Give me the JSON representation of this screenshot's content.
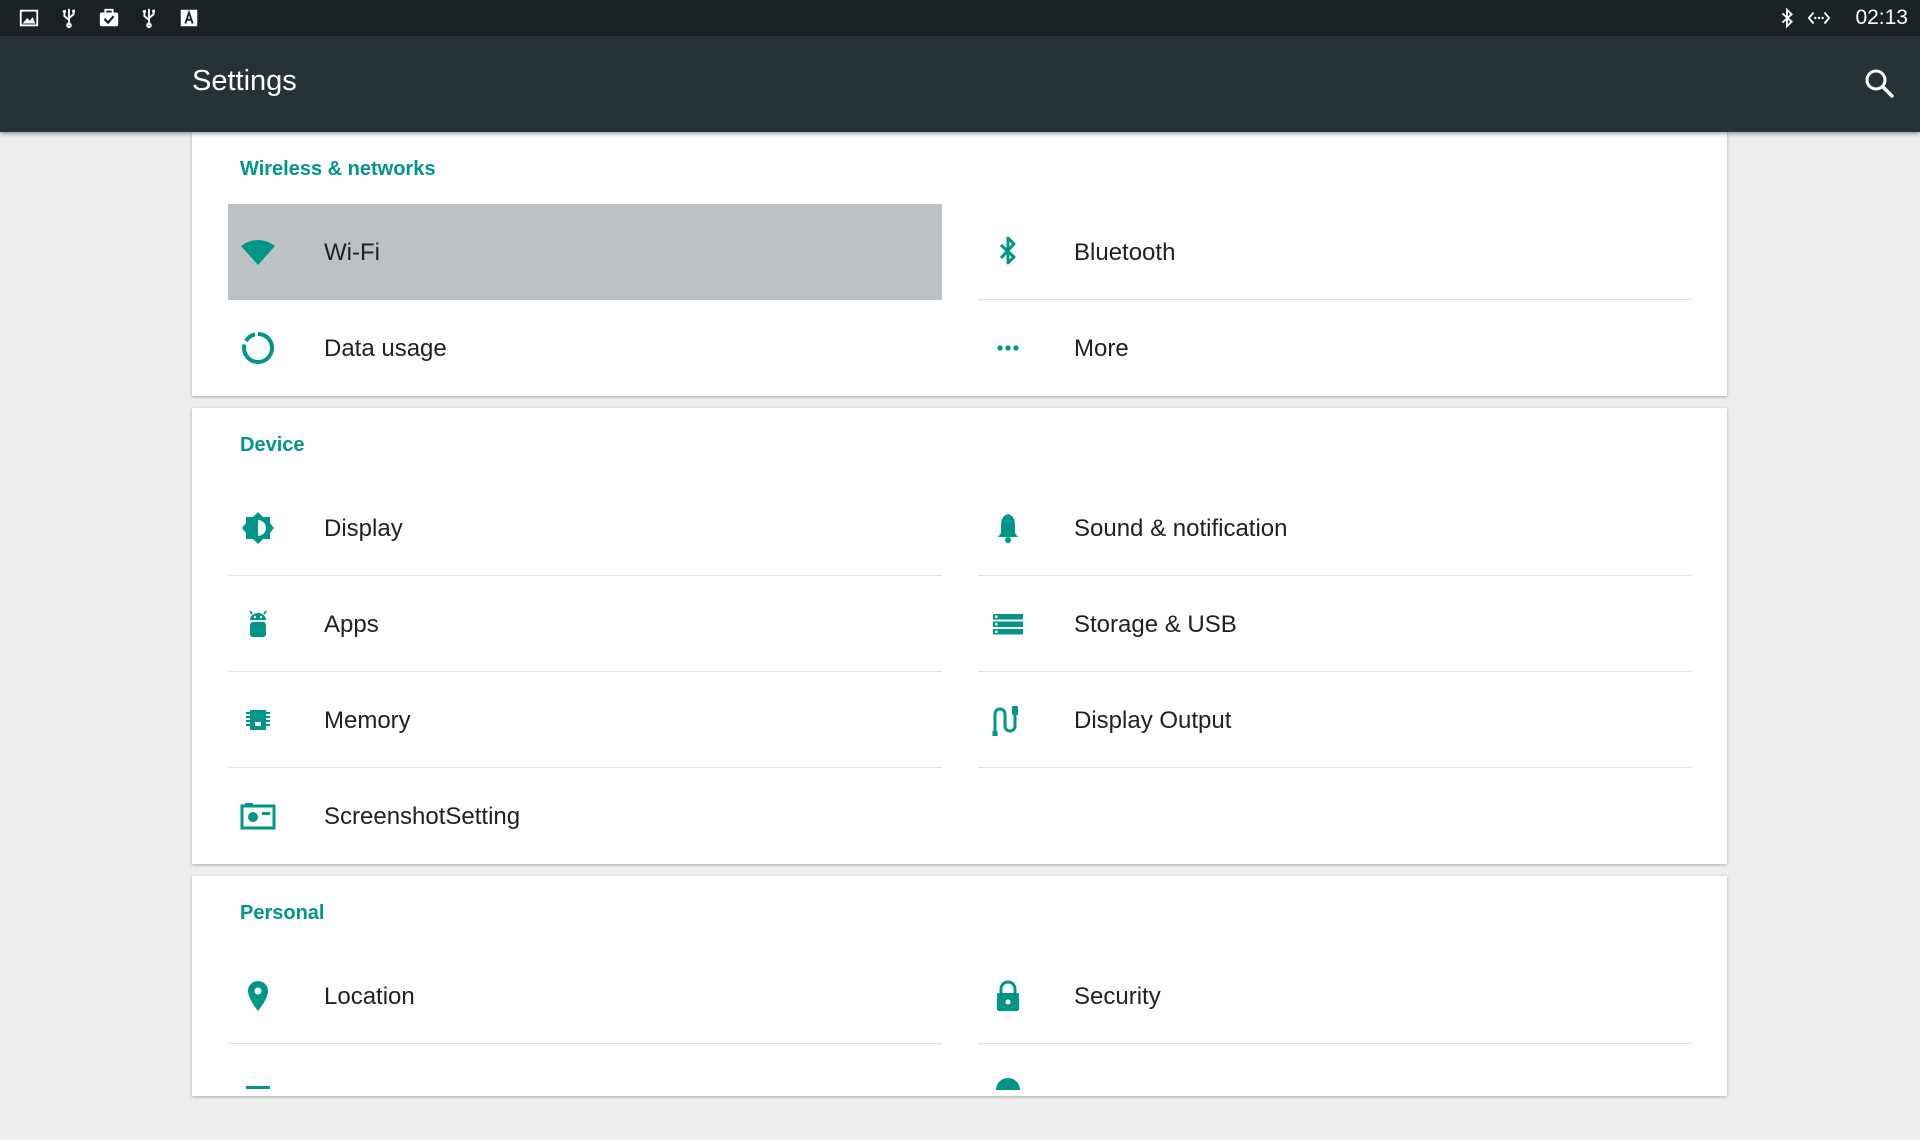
{
  "status_bar": {
    "time": "02:13",
    "left_icons": [
      "image-icon",
      "usb-icon",
      "briefcase-check-icon",
      "usb-icon",
      "keyboard-a-icon"
    ],
    "right_icons": [
      "bluetooth-icon",
      "code-arrows-icon"
    ]
  },
  "app_bar": {
    "title": "Settings",
    "search_icon": "search-icon"
  },
  "colors": {
    "accent": "#009688",
    "app_bar": "#263238",
    "status_bar": "#1b2226",
    "selected_row": "#bcc1c4",
    "background": "#eeeeee"
  },
  "sections": [
    {
      "header": "Wireless & networks",
      "items": [
        {
          "label": "Wi-Fi",
          "icon": "wifi-icon",
          "selected": true
        },
        {
          "label": "Bluetooth",
          "icon": "bluetooth-icon"
        },
        {
          "label": "Data usage",
          "icon": "data-usage-icon"
        },
        {
          "label": "More",
          "icon": "more-dots-icon"
        }
      ]
    },
    {
      "header": "Device",
      "items": [
        {
          "label": "Display",
          "icon": "brightness-icon"
        },
        {
          "label": "Sound & notification",
          "icon": "bell-icon"
        },
        {
          "label": "Apps",
          "icon": "android-icon"
        },
        {
          "label": "Storage & USB",
          "icon": "storage-icon"
        },
        {
          "label": "Memory",
          "icon": "memory-chip-icon"
        },
        {
          "label": "Display Output",
          "icon": "cable-icon"
        },
        {
          "label": "ScreenshotSetting",
          "icon": "screenshot-icon"
        }
      ]
    },
    {
      "header": "Personal",
      "items": [
        {
          "label": "Location",
          "icon": "location-pin-icon"
        },
        {
          "label": "Security",
          "icon": "lock-icon"
        }
      ]
    }
  ]
}
